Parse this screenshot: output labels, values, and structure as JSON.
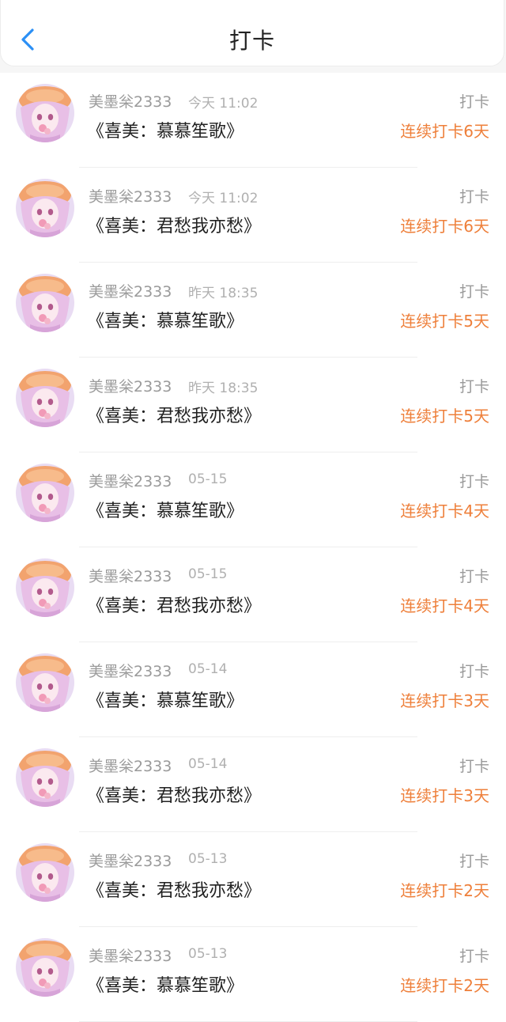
{
  "header": {
    "title": "打卡",
    "back_icon": "chevron-left-icon"
  },
  "colors": {
    "accent": "#2b8ff5",
    "streak": "#ee7f3a"
  },
  "records": [
    {
      "user": "美墨枀2333",
      "time": "今天 11:02",
      "work": "《喜美：慕慕笙歌》",
      "tag": "打卡",
      "streak": "连续打卡6天"
    },
    {
      "user": "美墨枀2333",
      "time": "今天 11:02",
      "work": "《喜美：君愁我亦愁》",
      "tag": "打卡",
      "streak": "连续打卡6天"
    },
    {
      "user": "美墨枀2333",
      "time": "昨天 18:35",
      "work": "《喜美：慕慕笙歌》",
      "tag": "打卡",
      "streak": "连续打卡5天"
    },
    {
      "user": "美墨枀2333",
      "time": "昨天 18:35",
      "work": "《喜美：君愁我亦愁》",
      "tag": "打卡",
      "streak": "连续打卡5天"
    },
    {
      "user": "美墨枀2333",
      "time": "05-15",
      "work": "《喜美：慕慕笙歌》",
      "tag": "打卡",
      "streak": "连续打卡4天"
    },
    {
      "user": "美墨枀2333",
      "time": "05-15",
      "work": "《喜美：君愁我亦愁》",
      "tag": "打卡",
      "streak": "连续打卡4天"
    },
    {
      "user": "美墨枀2333",
      "time": "05-14",
      "work": "《喜美：慕慕笙歌》",
      "tag": "打卡",
      "streak": "连续打卡3天"
    },
    {
      "user": "美墨枀2333",
      "time": "05-14",
      "work": "《喜美：君愁我亦愁》",
      "tag": "打卡",
      "streak": "连续打卡3天"
    },
    {
      "user": "美墨枀2333",
      "time": "05-13",
      "work": "《喜美：君愁我亦愁》",
      "tag": "打卡",
      "streak": "连续打卡2天"
    },
    {
      "user": "美墨枀2333",
      "time": "05-13",
      "work": "《喜美：慕慕笙歌》",
      "tag": "打卡",
      "streak": "连续打卡2天"
    }
  ]
}
